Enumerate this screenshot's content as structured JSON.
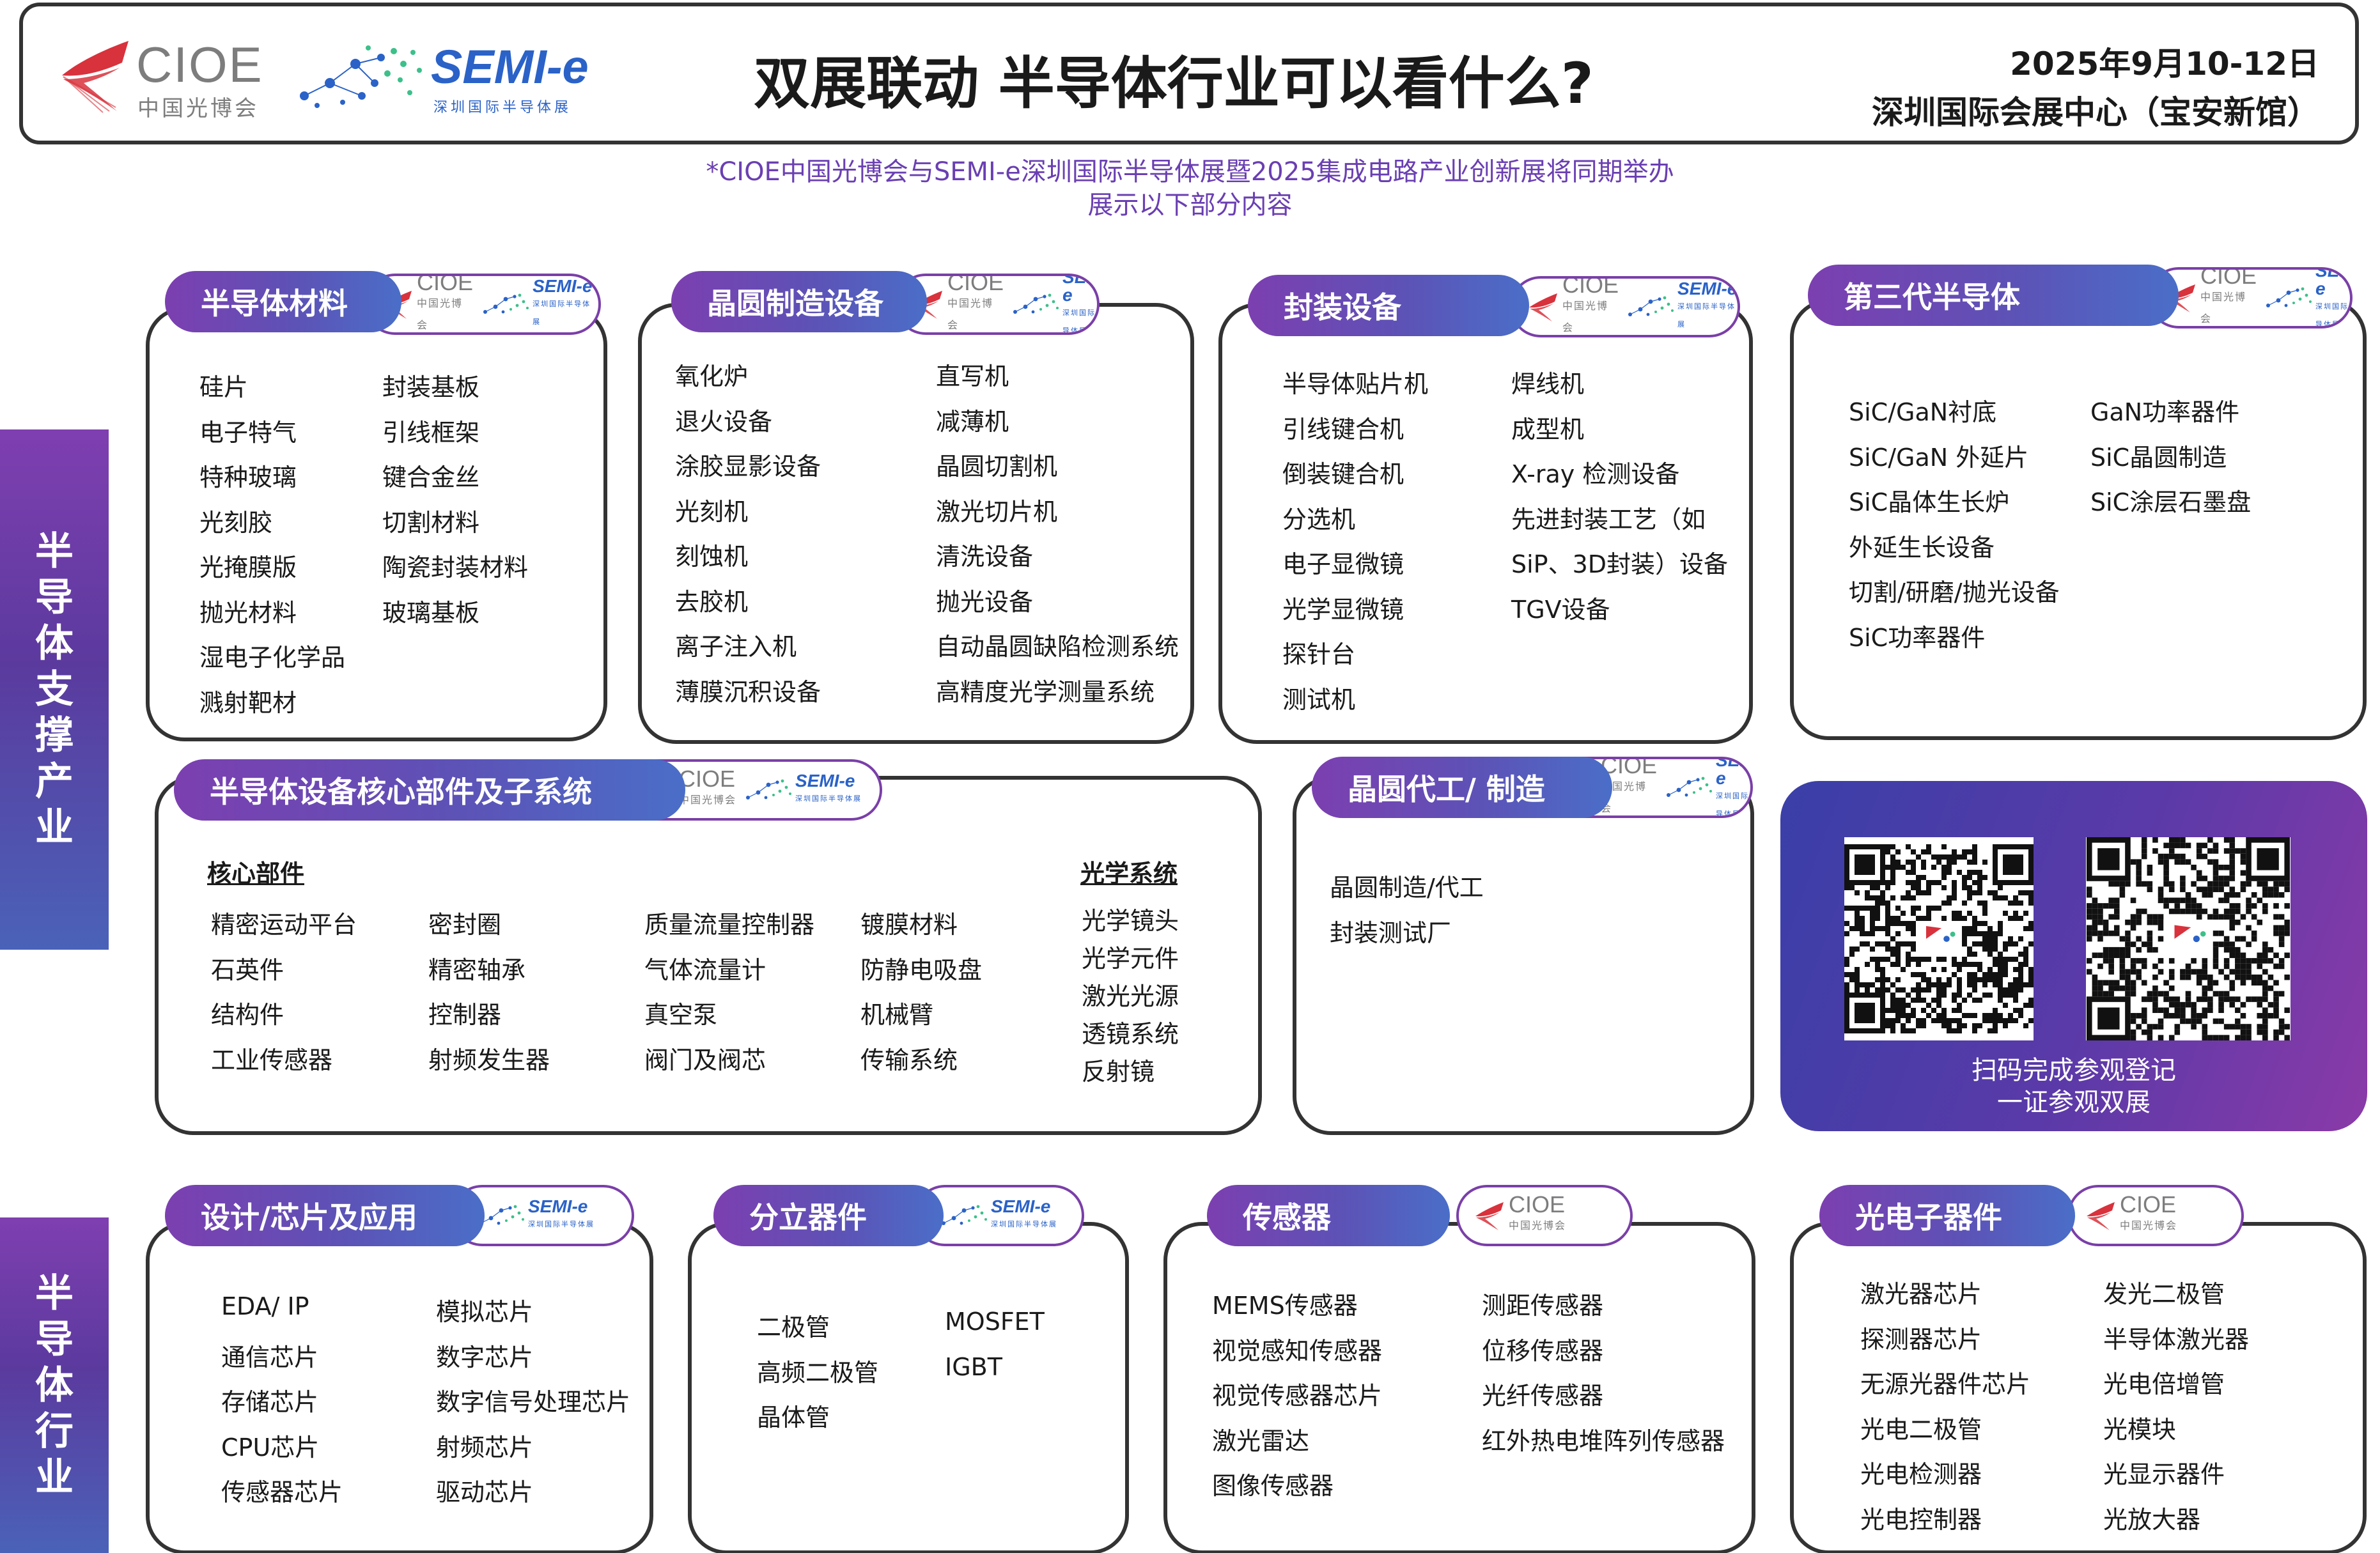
{
  "header": {
    "cioe_logo_text": "CIOE",
    "cioe_logo_sub": "中国光博会",
    "semi_logo_text": "SEMI-e",
    "semi_logo_sub": "深圳国际半导体展",
    "title": "双展联动 半导体行业可以看什么?",
    "date": "2025年9月10-12日",
    "venue": "深圳国际会展中心（宝安新馆）"
  },
  "subtitle": {
    "line1": "*CIOE中国光博会与SEMI-e深圳国际半导体展暨2025集成电路产业创新展将同期举办",
    "line2": "展示以下部分内容"
  },
  "side_labels": {
    "support": "半导体支撑产业",
    "industry": "半导体行业"
  },
  "badges": {
    "cioe": "CIOE",
    "cioe_sub": "中国光博会",
    "semi": "SEMI-e",
    "semi_sub": "深圳国际半导体展"
  },
  "colors": {
    "accent_purple": "#7c3fb0",
    "accent_blue": "#4a6ec8",
    "semi_blue": "#2a62c8",
    "cioe_red": "#d8323c",
    "border": "#333333"
  },
  "sections": {
    "materials": {
      "title": "半导体材料",
      "col1": [
        "硅片",
        "电子特气",
        "特种玻璃",
        "光刻胶",
        "光掩膜版",
        "抛光材料",
        "湿电子化学品",
        "溅射靶材"
      ],
      "col2": [
        "封装基板",
        "引线框架",
        "键合金丝",
        "切割材料",
        "陶瓷封装材料",
        "玻璃基板"
      ]
    },
    "wafer_equipment": {
      "title": "晶圆制造设备",
      "col1": [
        "氧化炉",
        "退火设备",
        "涂胶显影设备",
        "光刻机",
        "刻蚀机",
        "去胶机",
        "离子注入机",
        "薄膜沉积设备"
      ],
      "col2": [
        "直写机",
        "减薄机",
        "晶圆切割机",
        "激光切片机",
        "清洗设备",
        "抛光设备",
        "自动晶圆缺陷检测系统",
        "高精度光学测量系统"
      ]
    },
    "packaging_equipment": {
      "title": "封装设备",
      "col1": [
        "半导体贴片机",
        "引线键合机",
        "倒装键合机",
        "分选机",
        "电子显微镜",
        "光学显微镜",
        "探针台",
        "测试机"
      ],
      "col2": [
        "焊线机",
        "成型机",
        "X-ray 检测设备",
        "先进封装工艺（如",
        "SiP、3D封装）设备",
        "TGV设备"
      ]
    },
    "third_gen": {
      "title": "第三代半导体",
      "col1": [
        "SiC/GaN衬底",
        "SiC/GaN 外延片",
        "SiC晶体生长炉",
        "外延生长设备",
        "切割/研磨/抛光设备",
        "SiC功率器件"
      ],
      "col2": [
        "GaN功率器件",
        "SiC晶圆制造",
        "SiC涂层石墨盘"
      ]
    },
    "core_parts": {
      "title": "半导体设备核心部件及子系统",
      "heading_core": "核心部件",
      "heading_optical": "光学系统",
      "col1": [
        "精密运动平台",
        "石英件",
        "结构件",
        "工业传感器"
      ],
      "col2": [
        "密封圈",
        "精密轴承",
        "控制器",
        "射频发生器"
      ],
      "col3": [
        "质量流量控制器",
        "气体流量计",
        "真空泵",
        "阀门及阀芯"
      ],
      "col4": [
        "镀膜材料",
        "防静电吸盘",
        "机械臂",
        "传输系统"
      ],
      "col5": [
        "光学镜头",
        "光学元件",
        "激光光源",
        "透镜系统",
        "反射镜"
      ]
    },
    "foundry": {
      "title": "晶圆代工/ 制造",
      "col1": [
        "晶圆制造/代工",
        "封装测试厂"
      ]
    },
    "design": {
      "title": "设计/芯片及应用",
      "col1": [
        "EDA/ IP",
        "通信芯片",
        "存储芯片",
        "CPU芯片",
        "传感器芯片"
      ],
      "col2": [
        "模拟芯片",
        "数字芯片",
        "数字信号处理芯片",
        "射频芯片",
        "驱动芯片"
      ]
    },
    "discrete": {
      "title": "分立器件",
      "col1": [
        "二极管",
        "高频二极管",
        "晶体管"
      ],
      "col2": [
        "MOSFET",
        "IGBT"
      ]
    },
    "sensors": {
      "title": "传感器",
      "col1": [
        "MEMS传感器",
        "视觉感知传感器",
        "视觉传感器芯片",
        "激光雷达",
        "图像传感器"
      ],
      "col2": [
        "测距传感器",
        "位移传感器",
        "光纤传感器",
        "红外热电堆阵列传感器"
      ]
    },
    "optoelectronic": {
      "title": "光电子器件",
      "col1": [
        "激光器芯片",
        "探测器芯片",
        "无源光器件芯片",
        "光电二极管",
        "光电检测器",
        "光电控制器"
      ],
      "col2": [
        "发光二极管",
        "半导体激光器",
        "光电倍增管",
        "光模块",
        "光显示器件",
        "光放大器"
      ]
    }
  },
  "qr": {
    "caption1": "扫码完成参观登记",
    "caption2": "一证参观双展"
  }
}
